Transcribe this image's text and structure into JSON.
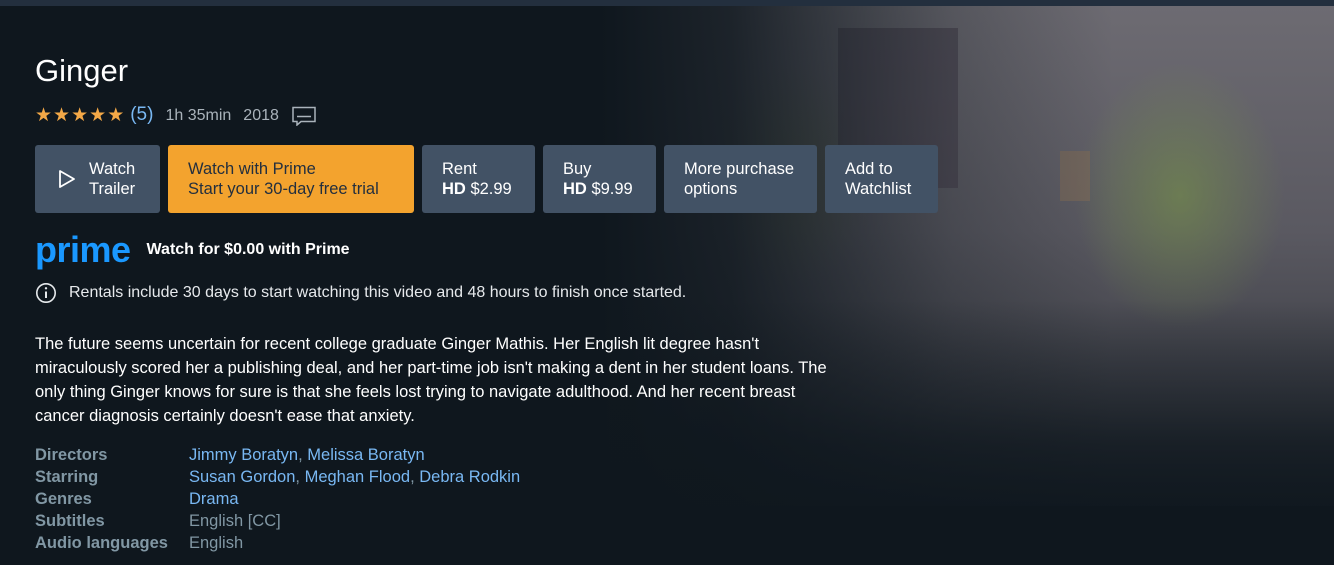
{
  "title": "Ginger",
  "rating": {
    "stars": 5,
    "count": "(5)"
  },
  "runtime": "1h 35min",
  "year": "2018",
  "icons": {
    "subtitles": "subtitles-icon",
    "play": "play-icon",
    "info": "info-icon",
    "star": "star-icon"
  },
  "colors": {
    "background": "#0f171e",
    "accent": "#f3a32e",
    "button": "#425265",
    "link": "#79b8f3",
    "prime": "#1a98ff"
  },
  "actions": {
    "watch_trailer": {
      "line1": "Watch",
      "line2": "Trailer"
    },
    "watch_prime": {
      "line1": "Watch with Prime",
      "line2": "Start your 30-day free trial"
    },
    "rent": {
      "line1": "Rent",
      "line2_strong": "HD",
      "line2": "$2.99"
    },
    "buy": {
      "line1": "Buy",
      "line2_strong": "HD",
      "line2": "$9.99"
    },
    "more": {
      "line1": "More purchase",
      "line2": "options"
    },
    "watchlist": {
      "line1": "Add to",
      "line2": "Watchlist"
    }
  },
  "prime": {
    "logo": "prime",
    "text": "Watch for $0.00 with Prime"
  },
  "notice": "Rentals include 30 days to start watching this video and 48 hours to finish once started.",
  "synopsis": "The future seems uncertain for recent college graduate Ginger Mathis. Her English lit degree hasn't miraculously scored her a publishing deal, and her part-time job isn't making a dent in her student loans. The only thing Ginger knows for sure is that she feels lost trying to navigate adulthood. And her recent breast cancer diagnosis certainly doesn't ease that anxiety.",
  "details": {
    "directors": {
      "label": "Directors",
      "values": [
        "Jimmy Boratyn",
        "Melissa Boratyn"
      ]
    },
    "starring": {
      "label": "Starring",
      "values": [
        "Susan Gordon",
        "Meghan Flood",
        "Debra Rodkin"
      ]
    },
    "genres": {
      "label": "Genres",
      "values": [
        "Drama"
      ]
    },
    "subtitles": {
      "label": "Subtitles",
      "value": "English [CC]"
    },
    "audio": {
      "label": "Audio languages",
      "value": "English"
    }
  }
}
